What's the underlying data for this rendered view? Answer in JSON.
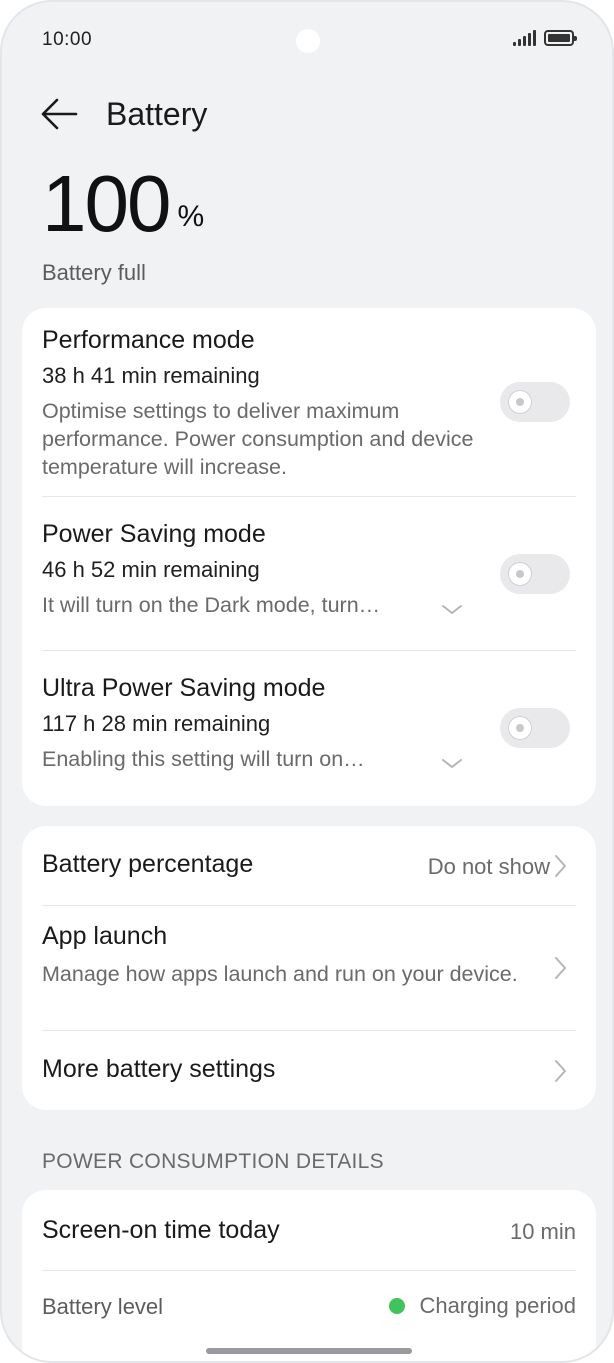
{
  "status_bar": {
    "time": "10:00"
  },
  "header": {
    "title": "Battery"
  },
  "battery": {
    "percent": "100",
    "percent_sign": "%",
    "status": "Battery full"
  },
  "modes": [
    {
      "title": "Performance mode",
      "remaining": "38 h 41 min remaining",
      "description": "Optimise settings to deliver maximum performance. Power consumption and device temperature will increase.",
      "enabled": false
    },
    {
      "title": "Power Saving mode",
      "remaining": "46 h 52 min remaining",
      "description": "It will turn on the Dark mode, turn…",
      "enabled": false
    },
    {
      "title": "Ultra Power Saving mode",
      "remaining": "117 h 28 min remaining",
      "description": "Enabling this setting will turn on…",
      "enabled": false
    }
  ],
  "settings": {
    "battery_percentage": {
      "label": "Battery percentage",
      "value": "Do not show"
    },
    "app_launch": {
      "label": "App launch",
      "description": "Manage how apps launch and run on your device."
    },
    "more_battery": {
      "label": "More battery settings"
    }
  },
  "power_details": {
    "section_label": "POWER CONSUMPTION DETAILS",
    "screen_on": {
      "label": "Screen-on time today",
      "value": "10 min"
    },
    "battery_level": {
      "label": "Battery level",
      "legend": "Charging period",
      "legend_color": "#3fc35b"
    }
  },
  "colors": {
    "background": "#f1f2f4",
    "card": "#ffffff",
    "toggle_off": "#e9e9ec"
  }
}
